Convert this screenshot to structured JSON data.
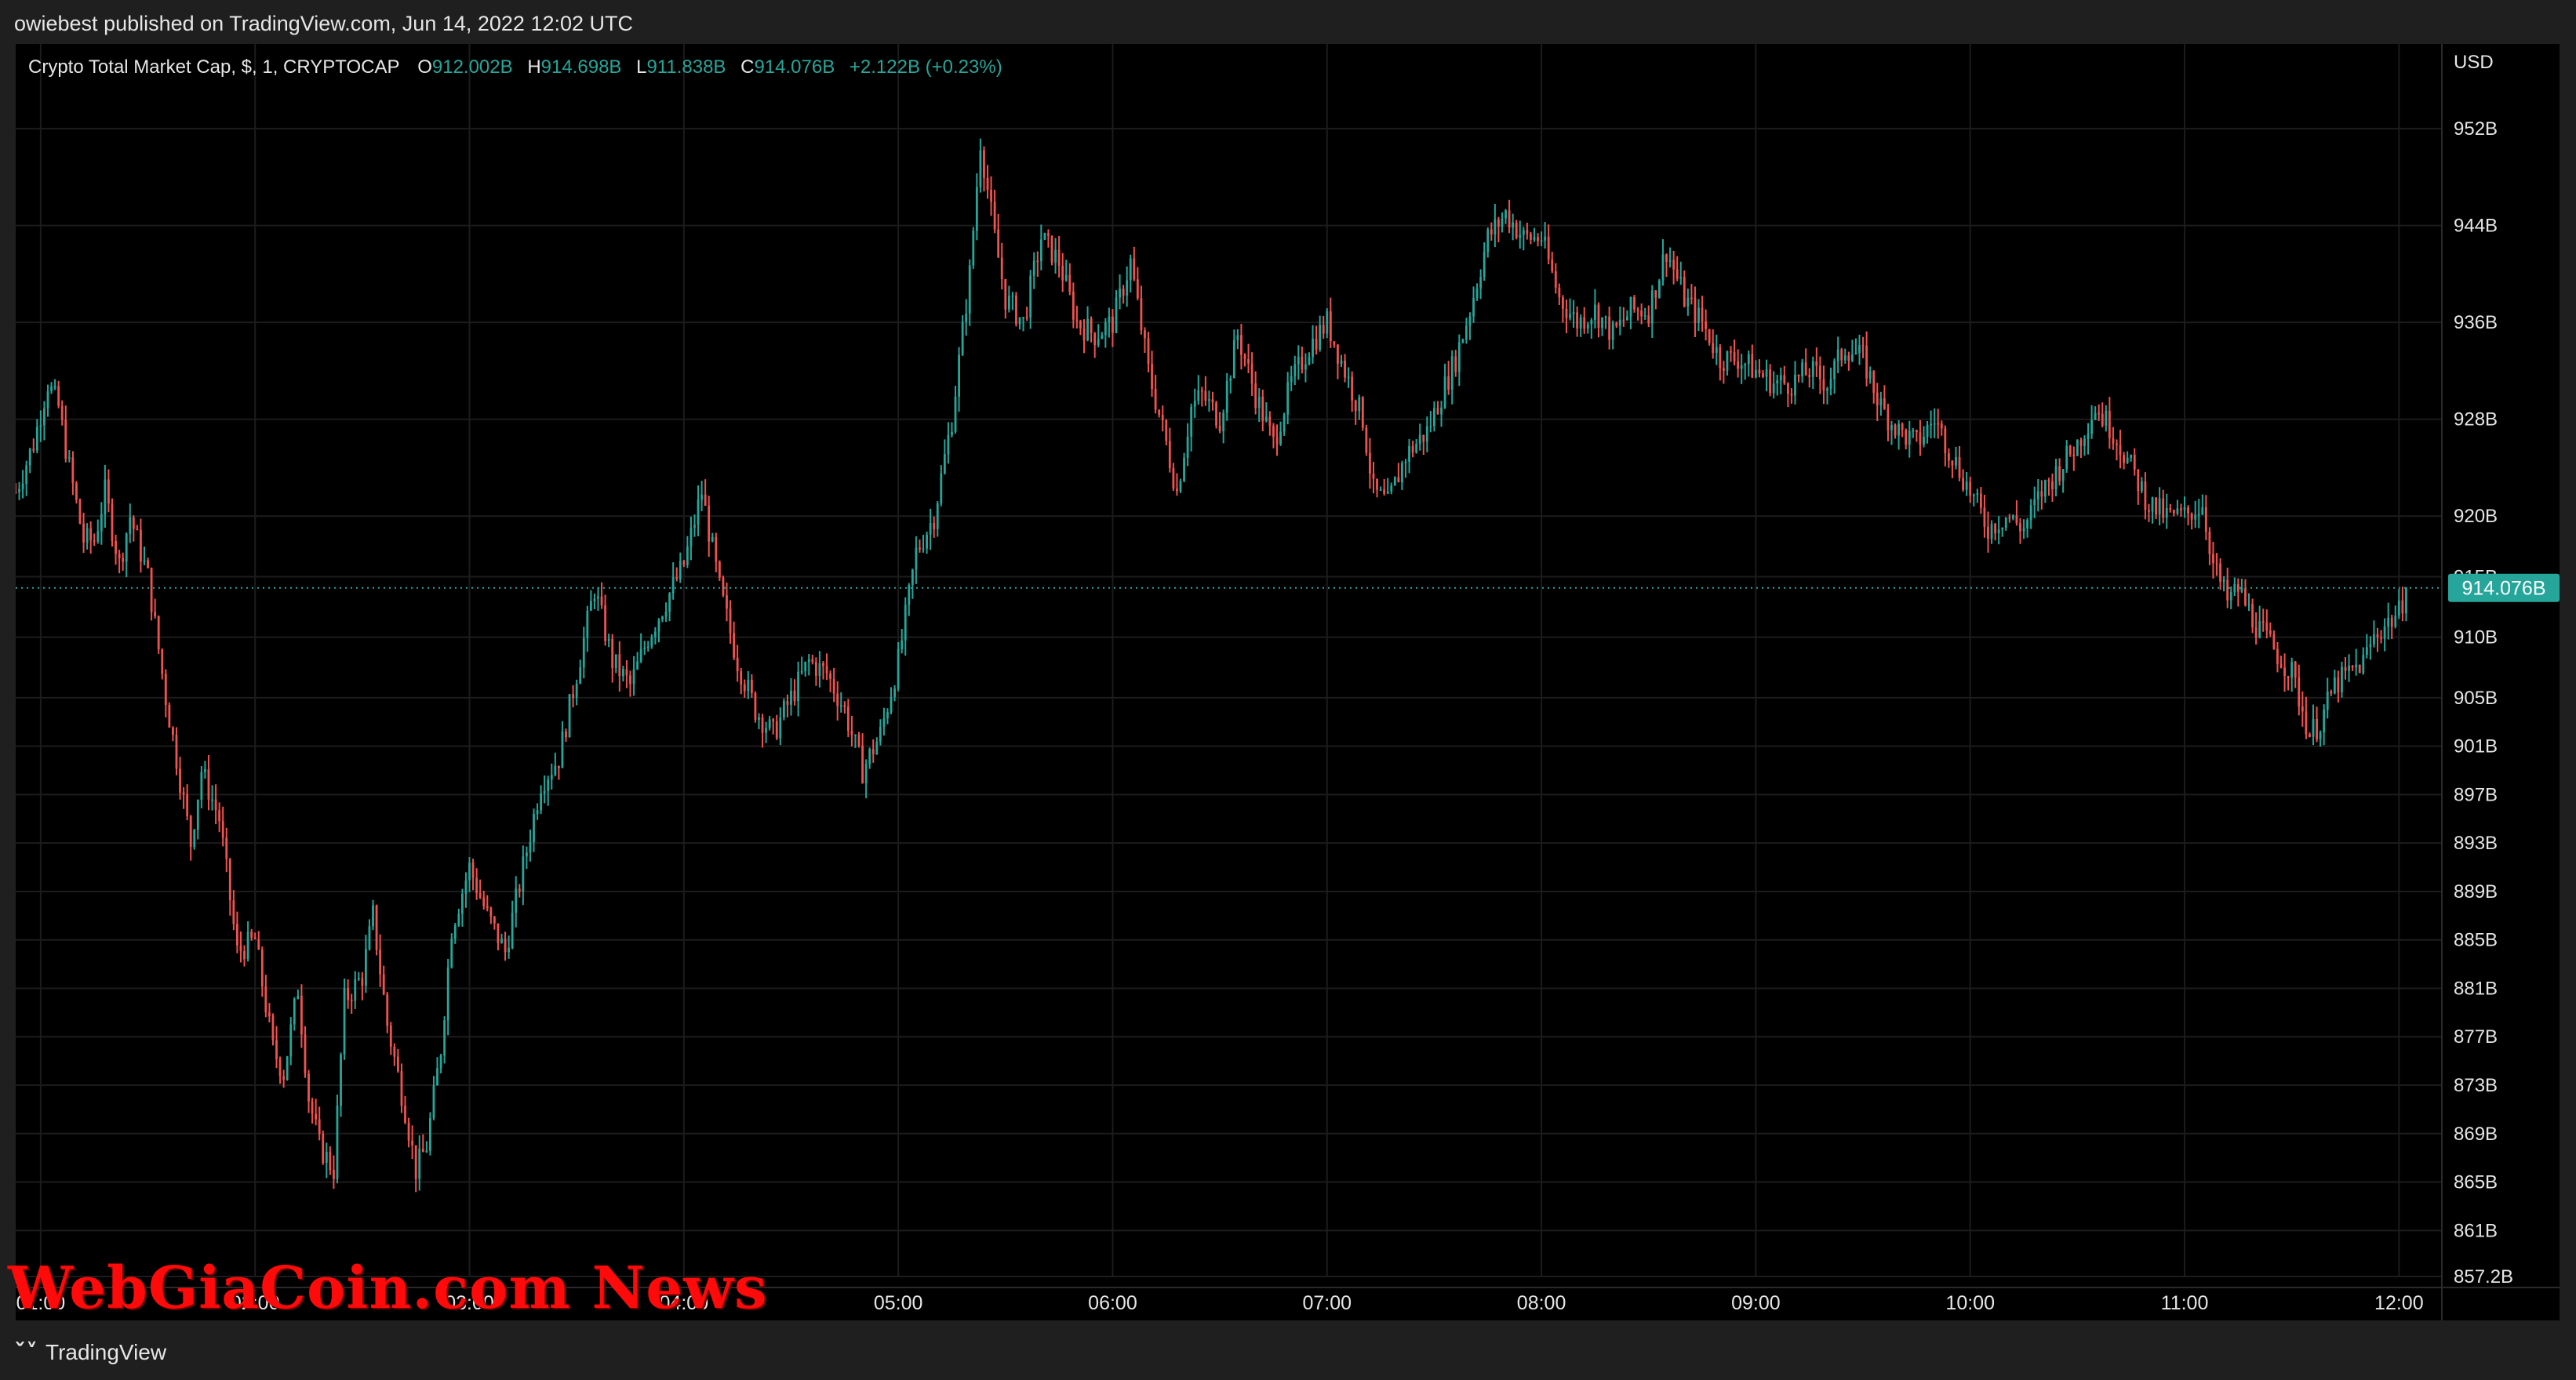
{
  "header": {
    "published": "owiebest published on TradingView.com, Jun 14, 2022 12:02 UTC"
  },
  "legend": {
    "symbol": "Crypto Total Market Cap, $, 1, CRYPTOCAP",
    "o_label": "O",
    "o_value": "912.002B",
    "h_label": "H",
    "h_value": "914.698B",
    "l_label": "L",
    "l_value": "911.838B",
    "c_label": "C",
    "c_value": "914.076B",
    "change": "+2.122B (+0.23%)"
  },
  "currency": "USD",
  "footer": {
    "brand": "TradingView"
  },
  "watermark": "WebGiaCoin.com News",
  "colors": {
    "up": "#26a69a",
    "down": "#ef5350",
    "background": "#000000",
    "grid": "#1c1c1c",
    "last_price_badge": "#26a69a"
  },
  "chart_data": {
    "type": "candlestick",
    "title": "Crypto Total Market Cap, $, 1, CRYPTOCAP",
    "interval": "1 minute",
    "date": "Jun 14, 2022",
    "ylabel": "USD",
    "ylim": [
      857.2,
      959
    ],
    "y_ticks": [
      "952B",
      "944B",
      "936B",
      "928B",
      "920B",
      "915B",
      "910B",
      "905B",
      "901B",
      "897B",
      "893B",
      "889B",
      "885B",
      "881B",
      "877B",
      "873B",
      "869B",
      "865B",
      "861B",
      "857.2B"
    ],
    "y_tick_values": [
      952,
      944,
      936,
      928,
      920,
      915,
      910,
      905,
      901,
      897,
      893,
      889,
      885,
      881,
      877,
      873,
      869,
      865,
      861,
      857.2
    ],
    "x_ticks": [
      "01:00",
      "02:00",
      "03:00",
      "04:00",
      "05:00",
      "06:00",
      "07:00",
      "08:00",
      "09:00",
      "10:00",
      "11:00",
      "12:00"
    ],
    "xlim": [
      "00:53",
      "12:12"
    ],
    "last_price": 914.076,
    "last_price_label": "914.076B",
    "grid": true,
    "price_path": [
      {
        "t": "00:53",
        "p": 922
      },
      {
        "t": "00:58",
        "p": 926
      },
      {
        "t": "01:02",
        "p": 931
      },
      {
        "t": "01:05",
        "p": 929
      },
      {
        "t": "01:08",
        "p": 924
      },
      {
        "t": "01:12",
        "p": 918
      },
      {
        "t": "01:15",
        "p": 918
      },
      {
        "t": "01:18",
        "p": 922
      },
      {
        "t": "01:22",
        "p": 916
      },
      {
        "t": "01:25",
        "p": 920
      },
      {
        "t": "01:30",
        "p": 915
      },
      {
        "t": "01:35",
        "p": 905
      },
      {
        "t": "01:38",
        "p": 900
      },
      {
        "t": "01:42",
        "p": 893
      },
      {
        "t": "01:45",
        "p": 899
      },
      {
        "t": "01:50",
        "p": 895
      },
      {
        "t": "01:55",
        "p": 884
      },
      {
        "t": "02:00",
        "p": 885
      },
      {
        "t": "02:05",
        "p": 876
      },
      {
        "t": "02:08",
        "p": 874
      },
      {
        "t": "02:12",
        "p": 881
      },
      {
        "t": "02:15",
        "p": 872
      },
      {
        "t": "02:18",
        "p": 868
      },
      {
        "t": "02:22",
        "p": 866
      },
      {
        "t": "02:25",
        "p": 880
      },
      {
        "t": "02:30",
        "p": 882
      },
      {
        "t": "02:33",
        "p": 887
      },
      {
        "t": "02:37",
        "p": 878
      },
      {
        "t": "02:42",
        "p": 871
      },
      {
        "t": "02:45",
        "p": 866
      },
      {
        "t": "02:48",
        "p": 868
      },
      {
        "t": "02:52",
        "p": 876
      },
      {
        "t": "02:55",
        "p": 886
      },
      {
        "t": "03:00",
        "p": 891
      },
      {
        "t": "03:05",
        "p": 887
      },
      {
        "t": "03:10",
        "p": 884
      },
      {
        "t": "03:15",
        "p": 891
      },
      {
        "t": "03:20",
        "p": 898
      },
      {
        "t": "03:25",
        "p": 900
      },
      {
        "t": "03:30",
        "p": 907
      },
      {
        "t": "03:35",
        "p": 914
      },
      {
        "t": "03:40",
        "p": 908
      },
      {
        "t": "03:45",
        "p": 906
      },
      {
        "t": "03:50",
        "p": 910
      },
      {
        "t": "03:55",
        "p": 913
      },
      {
        "t": "04:00",
        "p": 916
      },
      {
        "t": "04:05",
        "p": 922
      },
      {
        "t": "04:10",
        "p": 914
      },
      {
        "t": "04:15",
        "p": 908
      },
      {
        "t": "04:20",
        "p": 904
      },
      {
        "t": "04:25",
        "p": 902
      },
      {
        "t": "04:30",
        "p": 905
      },
      {
        "t": "04:35",
        "p": 908
      },
      {
        "t": "04:40",
        "p": 907
      },
      {
        "t": "04:45",
        "p": 904
      },
      {
        "t": "04:50",
        "p": 899
      },
      {
        "t": "04:55",
        "p": 902
      },
      {
        "t": "05:00",
        "p": 908
      },
      {
        "t": "05:05",
        "p": 917
      },
      {
        "t": "05:10",
        "p": 920
      },
      {
        "t": "05:15",
        "p": 928
      },
      {
        "t": "05:20",
        "p": 940
      },
      {
        "t": "05:23",
        "p": 951
      },
      {
        "t": "05:27",
        "p": 943
      },
      {
        "t": "05:30",
        "p": 938
      },
      {
        "t": "05:35",
        "p": 936
      },
      {
        "t": "05:40",
        "p": 943
      },
      {
        "t": "05:45",
        "p": 941
      },
      {
        "t": "05:50",
        "p": 936
      },
      {
        "t": "05:55",
        "p": 935
      },
      {
        "t": "06:00",
        "p": 936
      },
      {
        "t": "06:05",
        "p": 941
      },
      {
        "t": "06:10",
        "p": 932
      },
      {
        "t": "06:15",
        "p": 926
      },
      {
        "t": "06:18",
        "p": 922
      },
      {
        "t": "06:22",
        "p": 929
      },
      {
        "t": "06:25",
        "p": 930
      },
      {
        "t": "06:30",
        "p": 928
      },
      {
        "t": "06:35",
        "p": 935
      },
      {
        "t": "06:40",
        "p": 930
      },
      {
        "t": "06:45",
        "p": 926
      },
      {
        "t": "06:50",
        "p": 931
      },
      {
        "t": "06:55",
        "p": 934
      },
      {
        "t": "07:00",
        "p": 936
      },
      {
        "t": "07:05",
        "p": 932
      },
      {
        "t": "07:10",
        "p": 928
      },
      {
        "t": "07:13",
        "p": 922
      },
      {
        "t": "07:17",
        "p": 921
      },
      {
        "t": "07:22",
        "p": 925
      },
      {
        "t": "07:28",
        "p": 927
      },
      {
        "t": "07:32",
        "p": 930
      },
      {
        "t": "07:36",
        "p": 933
      },
      {
        "t": "07:40",
        "p": 937
      },
      {
        "t": "07:45",
        "p": 943
      },
      {
        "t": "07:50",
        "p": 945
      },
      {
        "t": "07:55",
        "p": 943
      },
      {
        "t": "08:00",
        "p": 943
      },
      {
        "t": "08:05",
        "p": 938
      },
      {
        "t": "08:10",
        "p": 936
      },
      {
        "t": "08:15",
        "p": 937
      },
      {
        "t": "08:20",
        "p": 935
      },
      {
        "t": "08:25",
        "p": 937
      },
      {
        "t": "08:30",
        "p": 937
      },
      {
        "t": "08:35",
        "p": 942
      },
      {
        "t": "08:40",
        "p": 938
      },
      {
        "t": "08:45",
        "p": 936
      },
      {
        "t": "08:50",
        "p": 933
      },
      {
        "t": "08:55",
        "p": 933
      },
      {
        "t": "09:00",
        "p": 932
      },
      {
        "t": "09:05",
        "p": 931
      },
      {
        "t": "09:10",
        "p": 931
      },
      {
        "t": "09:15",
        "p": 932
      },
      {
        "t": "09:20",
        "p": 931
      },
      {
        "t": "09:25",
        "p": 934
      },
      {
        "t": "09:30",
        "p": 933
      },
      {
        "t": "09:35",
        "p": 929
      },
      {
        "t": "09:40",
        "p": 927
      },
      {
        "t": "09:45",
        "p": 926
      },
      {
        "t": "09:50",
        "p": 928
      },
      {
        "t": "09:55",
        "p": 925
      },
      {
        "t": "10:00",
        "p": 922
      },
      {
        "t": "10:05",
        "p": 919
      },
      {
        "t": "10:10",
        "p": 920
      },
      {
        "t": "10:15",
        "p": 919
      },
      {
        "t": "10:20",
        "p": 922
      },
      {
        "t": "10:25",
        "p": 924
      },
      {
        "t": "10:30",
        "p": 926
      },
      {
        "t": "10:35",
        "p": 929
      },
      {
        "t": "10:40",
        "p": 927
      },
      {
        "t": "10:45",
        "p": 924
      },
      {
        "t": "10:50",
        "p": 921
      },
      {
        "t": "10:55",
        "p": 920
      },
      {
        "t": "11:00",
        "p": 920
      },
      {
        "t": "11:05",
        "p": 921
      },
      {
        "t": "11:08",
        "p": 916
      },
      {
        "t": "11:12",
        "p": 913
      },
      {
        "t": "11:15",
        "p": 914
      },
      {
        "t": "11:20",
        "p": 911
      },
      {
        "t": "11:25",
        "p": 909
      },
      {
        "t": "11:30",
        "p": 907
      },
      {
        "t": "11:35",
        "p": 902
      },
      {
        "t": "11:38",
        "p": 903
      },
      {
        "t": "11:42",
        "p": 906
      },
      {
        "t": "11:46",
        "p": 907
      },
      {
        "t": "11:50",
        "p": 908
      },
      {
        "t": "11:53",
        "p": 910
      },
      {
        "t": "11:56",
        "p": 911
      },
      {
        "t": "12:00",
        "p": 912
      },
      {
        "t": "12:02",
        "p": 914.076
      }
    ]
  }
}
